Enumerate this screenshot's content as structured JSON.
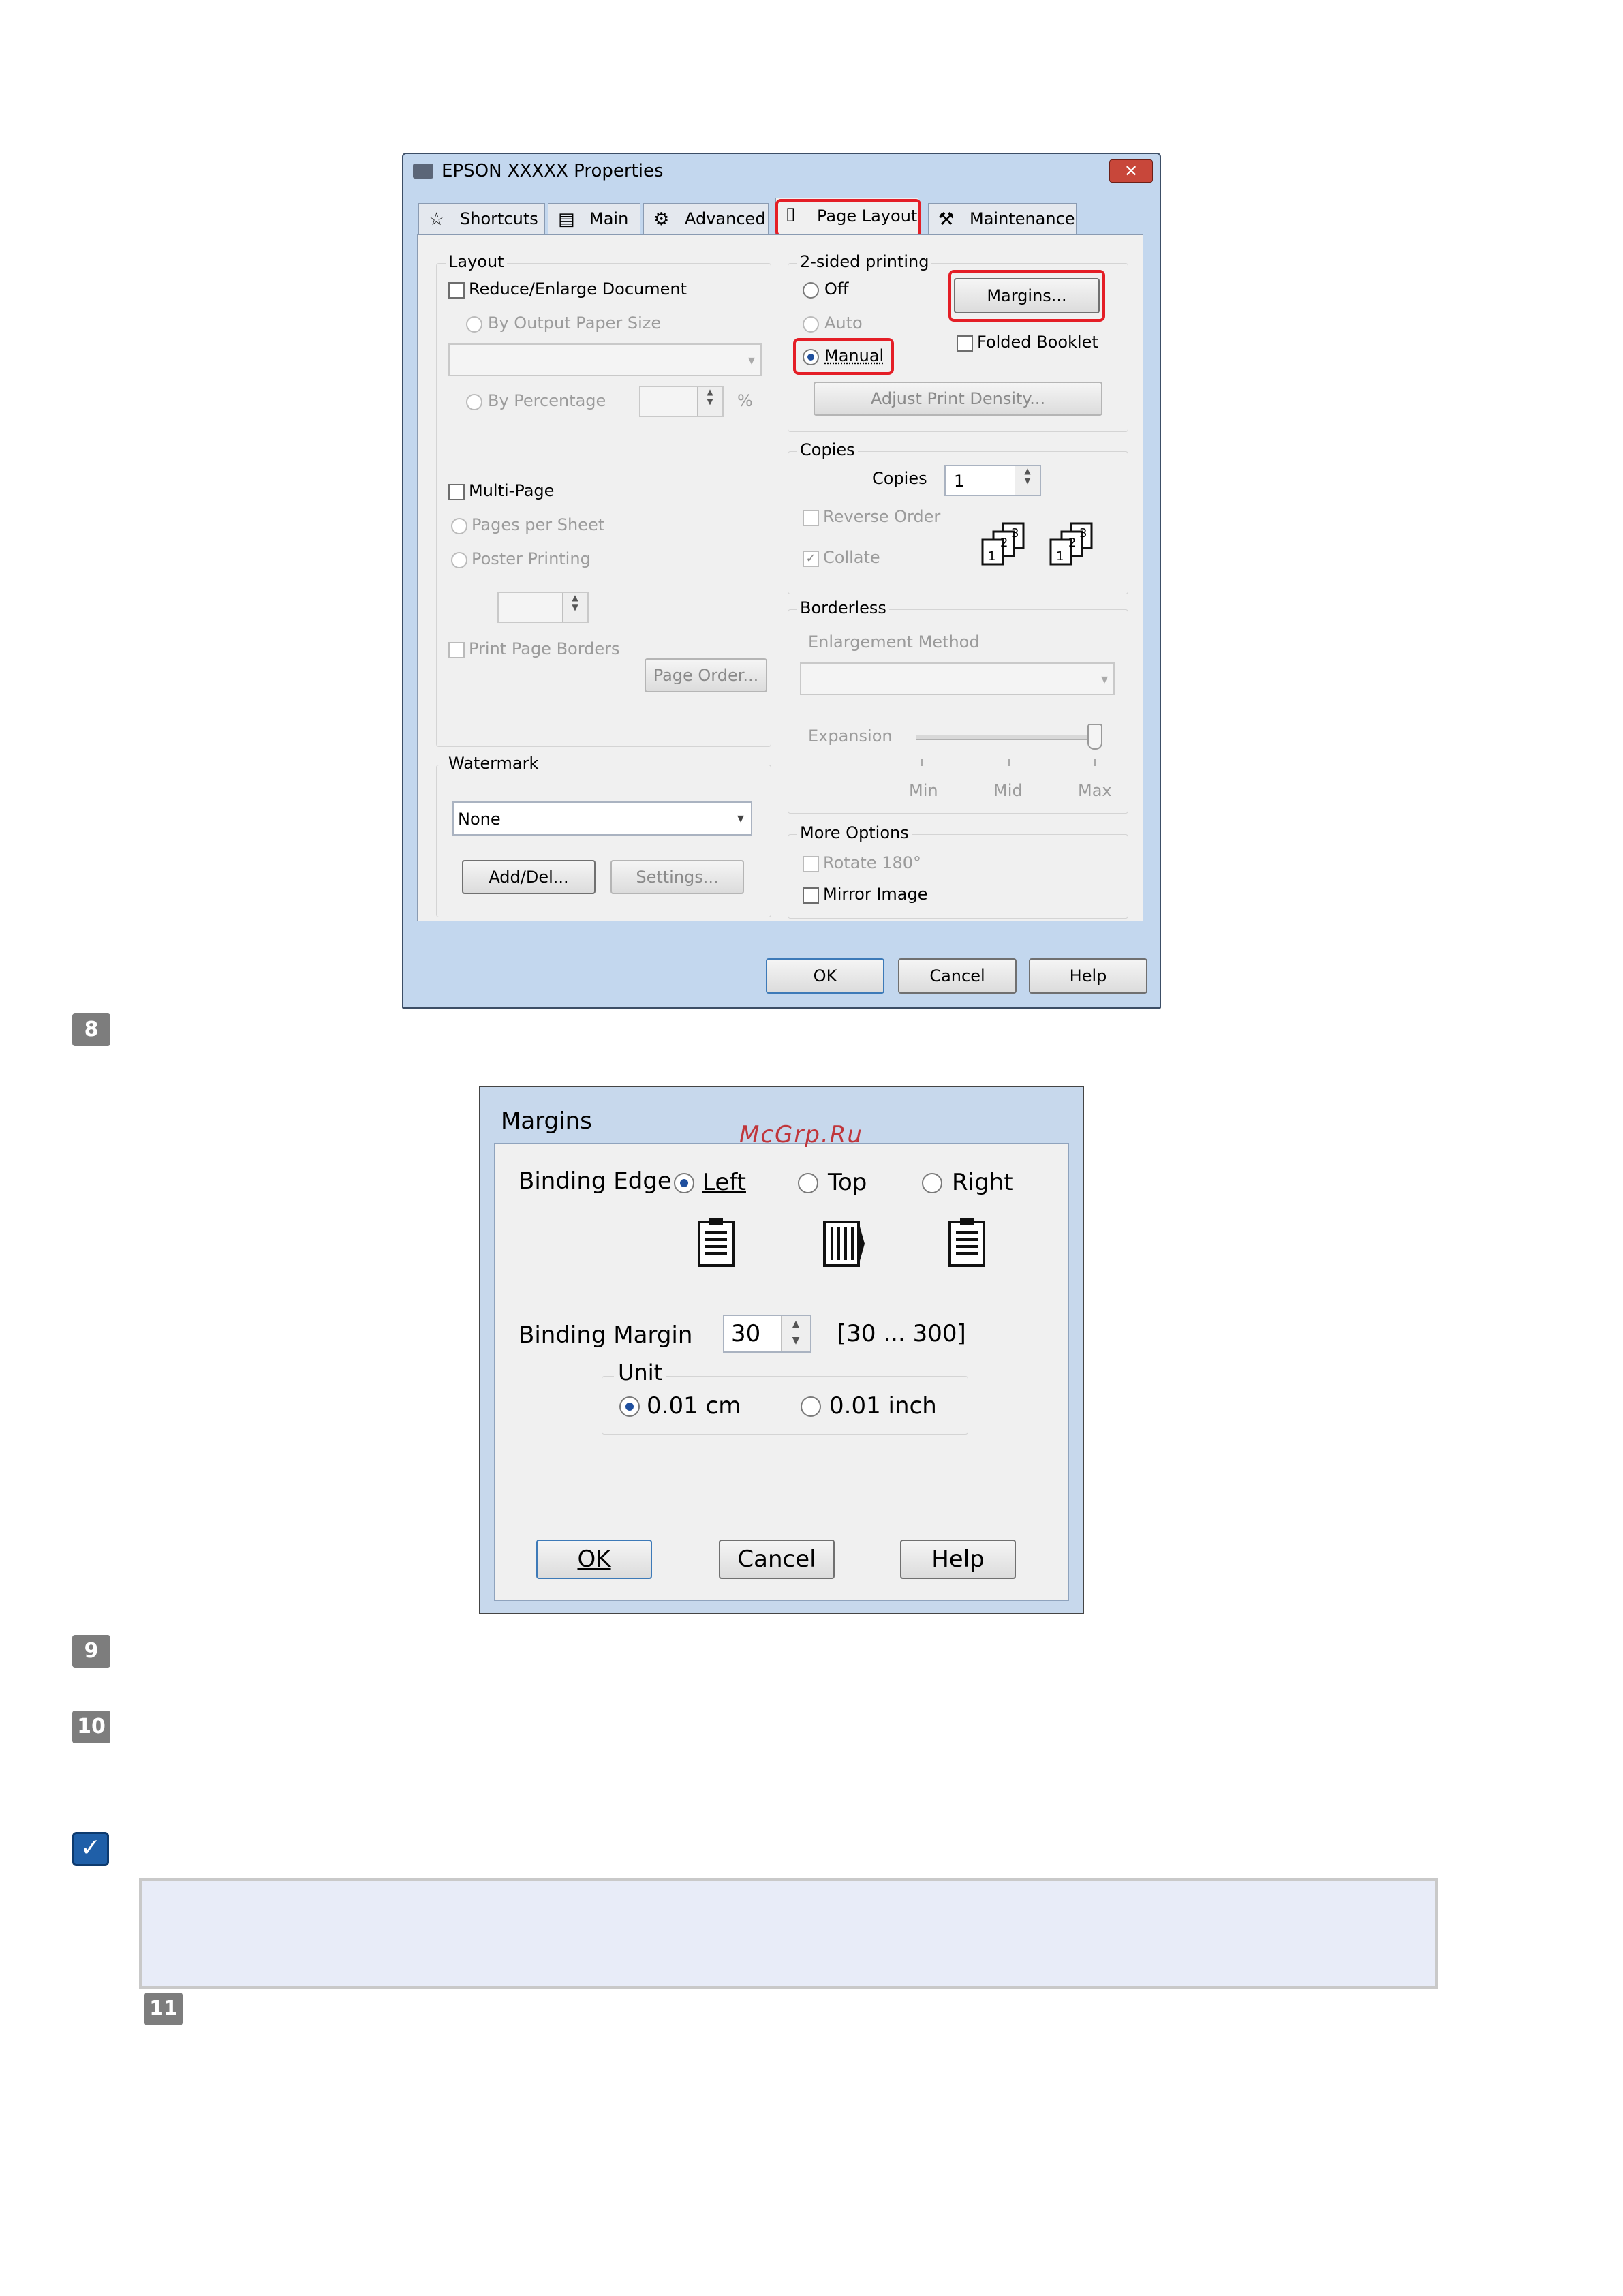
{
  "properties_window": {
    "title": "EPSON XXXXX Properties",
    "close": "✕",
    "tabs": [
      {
        "label": "Shortcuts"
      },
      {
        "label": "Main"
      },
      {
        "label": "Advanced"
      },
      {
        "label": "Page Layout"
      },
      {
        "label": "Maintenance"
      }
    ],
    "layout": {
      "group": "Layout",
      "reduce_enlarge": "Reduce/Enlarge Document",
      "by_output_paper": "By Output Paper Size",
      "by_percentage": "By Percentage",
      "percent_sign": "%",
      "multi_page": "Multi-Page",
      "pages_per_sheet": "Pages per Sheet",
      "poster_printing": "Poster Printing",
      "print_page_borders": "Print Page Borders",
      "page_order": "Page Order..."
    },
    "watermark": {
      "group": "Watermark",
      "value": "None",
      "add_del": "Add/Del...",
      "settings": "Settings..."
    },
    "two_sided": {
      "group": "2-sided printing",
      "off": "Off",
      "auto": "Auto",
      "manual": "Manual",
      "margins": "Margins...",
      "folded_booklet": "Folded Booklet",
      "adjust_density": "Adjust Print Density..."
    },
    "copies": {
      "group": "Copies",
      "label": "Copies",
      "value": "1",
      "reverse_order": "Reverse Order",
      "collate": "Collate"
    },
    "borderless": {
      "group": "Borderless",
      "enlargement_method": "Enlargement Method",
      "expansion": "Expansion",
      "min": "Min",
      "mid": "Mid",
      "max": "Max"
    },
    "more_options": {
      "group": "More Options",
      "rotate": "Rotate 180°",
      "mirror": "Mirror Image"
    },
    "buttons": {
      "ok": "OK",
      "cancel": "Cancel",
      "help": "Help"
    }
  },
  "steps": {
    "s8": "8",
    "s9": "9",
    "s10": "10",
    "s11": "11"
  },
  "margins_dialog": {
    "title": "Margins",
    "watermark": "McGrp.Ru",
    "binding_edge": "Binding Edge",
    "left": "Left",
    "top": "Top",
    "right": "Right",
    "binding_margin": "Binding Margin",
    "margin_value": "30",
    "range": "[30 ... 300]",
    "unit": "Unit",
    "unit_cm": "0.01 cm",
    "unit_inch": "0.01 inch",
    "ok": "OK",
    "cancel": "Cancel",
    "help": "Help"
  },
  "colors": {
    "highlight": "#e41e26",
    "note_box": "#e8ecf8"
  }
}
